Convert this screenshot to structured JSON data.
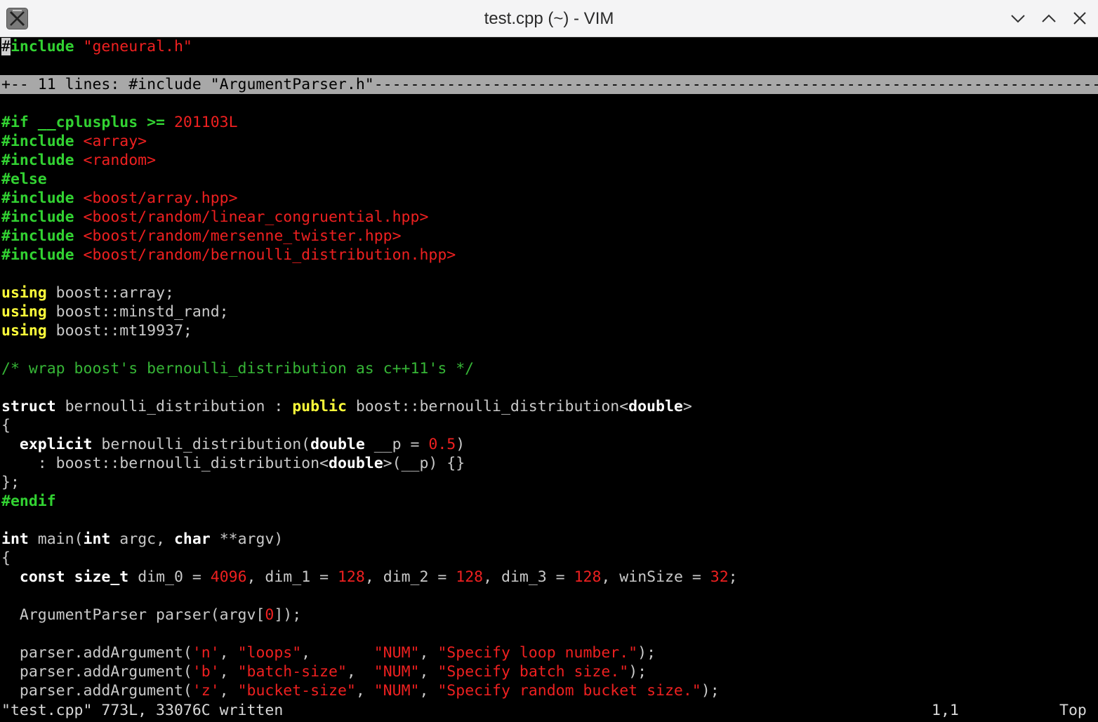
{
  "window": {
    "title": "test.cpp (~) - VIM",
    "controls": [
      "minimize",
      "maximize",
      "close"
    ]
  },
  "buffer": {
    "lines": [
      [
        {
          "t": "#",
          "c": "cursor"
        },
        {
          "t": "include",
          "c": "pp"
        },
        {
          "t": " ",
          "c": "txt"
        },
        {
          "t": "\"geneural.h\"",
          "c": "str"
        }
      ],
      [],
      [
        {
          "t": "+-- 11 lines: #include \"ArgumentParser.h\"--------------------------------------------------------------------------------",
          "c": "fold-text"
        }
      ],
      [],
      [
        {
          "t": "#if __cplusplus >=",
          "c": "pp"
        },
        {
          "t": " ",
          "c": "txt"
        },
        {
          "t": "201103L",
          "c": "num"
        }
      ],
      [
        {
          "t": "#include",
          "c": "pp"
        },
        {
          "t": " ",
          "c": "txt"
        },
        {
          "t": "<array>",
          "c": "str"
        }
      ],
      [
        {
          "t": "#include",
          "c": "pp"
        },
        {
          "t": " ",
          "c": "txt"
        },
        {
          "t": "<random>",
          "c": "str"
        }
      ],
      [
        {
          "t": "#else",
          "c": "pp"
        }
      ],
      [
        {
          "t": "#include",
          "c": "pp"
        },
        {
          "t": " ",
          "c": "txt"
        },
        {
          "t": "<boost/array.hpp>",
          "c": "str"
        }
      ],
      [
        {
          "t": "#include",
          "c": "pp"
        },
        {
          "t": " ",
          "c": "txt"
        },
        {
          "t": "<boost/random/linear_congruential.hpp>",
          "c": "str"
        }
      ],
      [
        {
          "t": "#include",
          "c": "pp"
        },
        {
          "t": " ",
          "c": "txt"
        },
        {
          "t": "<boost/random/mersenne_twister.hpp>",
          "c": "str"
        }
      ],
      [
        {
          "t": "#include",
          "c": "pp"
        },
        {
          "t": " ",
          "c": "txt"
        },
        {
          "t": "<boost/random/bernoulli_distribution.hpp>",
          "c": "str"
        }
      ],
      [],
      [
        {
          "t": "using",
          "c": "kw"
        },
        {
          "t": " boost::array;",
          "c": "txt"
        }
      ],
      [
        {
          "t": "using",
          "c": "kw"
        },
        {
          "t": " boost::minstd_rand;",
          "c": "txt"
        }
      ],
      [
        {
          "t": "using",
          "c": "kw"
        },
        {
          "t": " boost::mt19937;",
          "c": "txt"
        }
      ],
      [],
      [
        {
          "t": "/* wrap boost's bernoulli_distribution as c++11's */",
          "c": "cm"
        }
      ],
      [],
      [
        {
          "t": "struct",
          "c": "ty"
        },
        {
          "t": " bernoulli_distribution : ",
          "c": "txt"
        },
        {
          "t": "public",
          "c": "kw"
        },
        {
          "t": " boost::bernoulli_distribution<",
          "c": "txt"
        },
        {
          "t": "double",
          "c": "ty"
        },
        {
          "t": ">",
          "c": "txt"
        }
      ],
      [
        {
          "t": "{",
          "c": "txt"
        }
      ],
      [
        {
          "t": "  ",
          "c": "txt"
        },
        {
          "t": "explicit",
          "c": "ty"
        },
        {
          "t": " bernoulli_distribution(",
          "c": "txt"
        },
        {
          "t": "double",
          "c": "ty"
        },
        {
          "t": " __p = ",
          "c": "txt"
        },
        {
          "t": "0.5",
          "c": "num"
        },
        {
          "t": ")",
          "c": "txt"
        }
      ],
      [
        {
          "t": "    : boost::bernoulli_distribution<",
          "c": "txt"
        },
        {
          "t": "double",
          "c": "ty"
        },
        {
          "t": ">(__p) {}",
          "c": "txt"
        }
      ],
      [
        {
          "t": "};",
          "c": "txt"
        }
      ],
      [
        {
          "t": "#endif",
          "c": "pp"
        }
      ],
      [],
      [
        {
          "t": "int",
          "c": "ty"
        },
        {
          "t": " main(",
          "c": "txt"
        },
        {
          "t": "int",
          "c": "ty"
        },
        {
          "t": " argc, ",
          "c": "txt"
        },
        {
          "t": "char",
          "c": "ty"
        },
        {
          "t": " **argv)",
          "c": "txt"
        }
      ],
      [
        {
          "t": "{",
          "c": "txt"
        }
      ],
      [
        {
          "t": "  ",
          "c": "txt"
        },
        {
          "t": "const",
          "c": "ty"
        },
        {
          "t": " ",
          "c": "txt"
        },
        {
          "t": "size_t",
          "c": "ty"
        },
        {
          "t": " dim_0 = ",
          "c": "txt"
        },
        {
          "t": "4096",
          "c": "num"
        },
        {
          "t": ", dim_1 = ",
          "c": "txt"
        },
        {
          "t": "128",
          "c": "num"
        },
        {
          "t": ", dim_2 = ",
          "c": "txt"
        },
        {
          "t": "128",
          "c": "num"
        },
        {
          "t": ", dim_3 = ",
          "c": "txt"
        },
        {
          "t": "128",
          "c": "num"
        },
        {
          "t": ", winSize = ",
          "c": "txt"
        },
        {
          "t": "32",
          "c": "num"
        },
        {
          "t": ";",
          "c": "txt"
        }
      ],
      [],
      [
        {
          "t": "  ArgumentParser parser(argv[",
          "c": "txt"
        },
        {
          "t": "0",
          "c": "num"
        },
        {
          "t": "]);",
          "c": "txt"
        }
      ],
      [],
      [
        {
          "t": "  parser.addArgument(",
          "c": "txt"
        },
        {
          "t": "'n'",
          "c": "str"
        },
        {
          "t": ", ",
          "c": "txt"
        },
        {
          "t": "\"loops\"",
          "c": "str"
        },
        {
          "t": ",       ",
          "c": "txt"
        },
        {
          "t": "\"NUM\"",
          "c": "str"
        },
        {
          "t": ", ",
          "c": "txt"
        },
        {
          "t": "\"Specify loop number.\"",
          "c": "str"
        },
        {
          "t": ");",
          "c": "txt"
        }
      ],
      [
        {
          "t": "  parser.addArgument(",
          "c": "txt"
        },
        {
          "t": "'b'",
          "c": "str"
        },
        {
          "t": ", ",
          "c": "txt"
        },
        {
          "t": "\"batch-size\"",
          "c": "str"
        },
        {
          "t": ",  ",
          "c": "txt"
        },
        {
          "t": "\"NUM\"",
          "c": "str"
        },
        {
          "t": ", ",
          "c": "txt"
        },
        {
          "t": "\"Specify batch size.\"",
          "c": "str"
        },
        {
          "t": ");",
          "c": "txt"
        }
      ],
      [
        {
          "t": "  parser.addArgument(",
          "c": "txt"
        },
        {
          "t": "'z'",
          "c": "str"
        },
        {
          "t": ", ",
          "c": "txt"
        },
        {
          "t": "\"bucket-size\"",
          "c": "str"
        },
        {
          "t": ", ",
          "c": "txt"
        },
        {
          "t": "\"NUM\"",
          "c": "str"
        },
        {
          "t": ", ",
          "c": "txt"
        },
        {
          "t": "\"Specify random bucket size.\"",
          "c": "str"
        },
        {
          "t": ");",
          "c": "txt"
        }
      ]
    ]
  },
  "status": {
    "message": "\"test.cpp\" 773L, 33076C written",
    "position": "1,1",
    "scroll": "Top"
  }
}
